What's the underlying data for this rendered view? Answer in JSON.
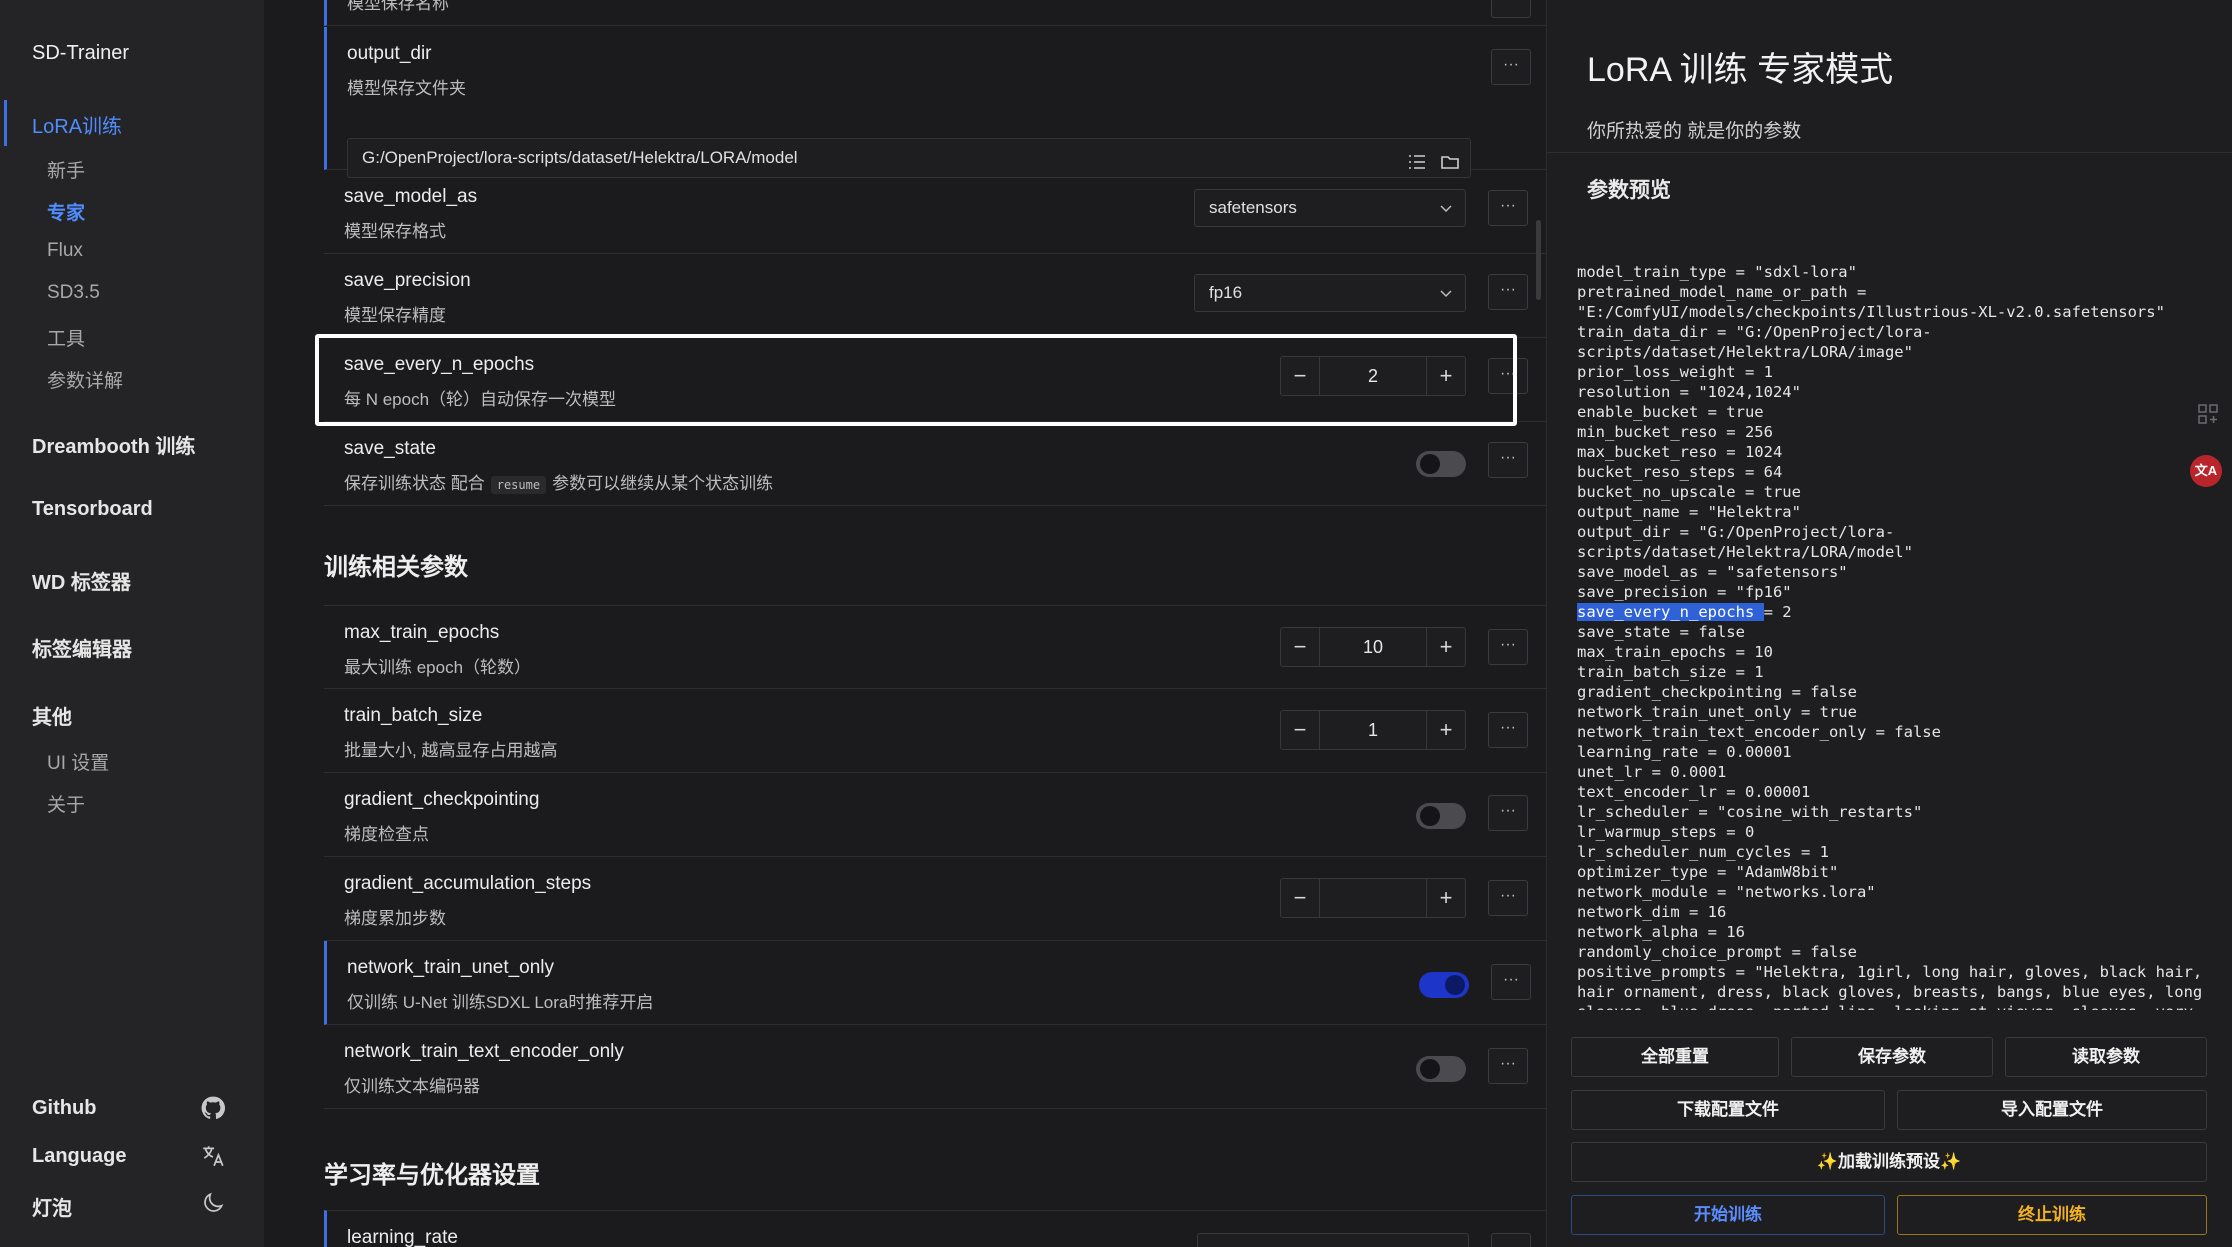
{
  "sidebar": {
    "brand": "SD-Trainer",
    "lora_group": "LoRA训练",
    "lora_items": [
      "新手",
      "专家",
      "Flux",
      "SD3.5",
      "工具",
      "参数详解"
    ],
    "groups": [
      "Dreambooth 训练",
      "Tensorboard",
      "WD 标签器",
      "标签编辑器",
      "其他"
    ],
    "other_items": [
      "UI 设置",
      "关于"
    ],
    "bottom": [
      {
        "label": "Github",
        "icon": "github-icon"
      },
      {
        "label": "Language",
        "icon": "translate-icon"
      },
      {
        "label": "灯泡",
        "icon": "moon-icon"
      }
    ]
  },
  "main": {
    "top_cut_label": "模型保存名称",
    "output_dir": {
      "name": "output_dir",
      "desc": "模型保存文件夹",
      "value": "G:/OpenProject/lora-scripts/dataset/Helektra/LORA/model"
    },
    "save_model_as": {
      "name": "save_model_as",
      "desc": "模型保存格式",
      "value": "safetensors"
    },
    "save_precision": {
      "name": "save_precision",
      "desc": "模型保存精度",
      "value": "fp16"
    },
    "save_every_n_epochs": {
      "name": "save_every_n_epochs",
      "desc": "每 N epoch（轮）自动保存一次模型",
      "value": "2"
    },
    "save_state": {
      "name": "save_state",
      "desc_pre": "保存训练状态 配合",
      "desc_code": "resume",
      "desc_post": "参数可以继续从某个状态训练"
    },
    "section_training": "训练相关参数",
    "max_train_epochs": {
      "name": "max_train_epochs",
      "desc": "最大训练 epoch（轮数）",
      "value": "10"
    },
    "train_batch_size": {
      "name": "train_batch_size",
      "desc": "批量大小, 越高显存占用越高",
      "value": "1"
    },
    "gradient_checkpointing": {
      "name": "gradient_checkpointing",
      "desc": "梯度检查点"
    },
    "gradient_accumulation_steps": {
      "name": "gradient_accumulation_steps",
      "desc": "梯度累加步数",
      "value": ""
    },
    "network_train_unet_only": {
      "name": "network_train_unet_only",
      "desc": "仅训练 U-Net 训练SDXL Lora时推荐开启"
    },
    "network_train_text_encoder_only": {
      "name": "network_train_text_encoder_only",
      "desc": "仅训练文本编码器"
    },
    "section_lr": "学习率与优化器设置",
    "learning_rate": {
      "name": "learning_rate"
    },
    "toggles": {
      "save_state": false,
      "gradient_checkpointing": false,
      "network_train_unet_only": true,
      "network_train_text_encoder_only": false
    },
    "more_label": "···",
    "minus": "−",
    "plus": "+"
  },
  "right": {
    "title": "LoRA 训练 专家模式",
    "subtitle": "你所热爱的 就是你的参数",
    "preview_label": "参数预览",
    "code_before": "model_train_type = \"sdxl-lora\"\npretrained_model_name_or_path = \n\"E:/ComfyUI/models/checkpoints/Illustrious-XL-v2.0.safetensors\"\ntrain_data_dir = \"G:/OpenProject/lora-\nscripts/dataset/Helektra/LORA/image\"\nprior_loss_weight = 1\nresolution = \"1024,1024\"\nenable_bucket = true\nmin_bucket_reso = 256\nmax_bucket_reso = 1024\nbucket_reso_steps = 64\nbucket_no_upscale = true\noutput_name = \"Helektra\"\noutput_dir = \"G:/OpenProject/lora-\nscripts/dataset/Helektra/LORA/model\"\nsave_model_as = \"safetensors\"\nsave_precision = \"fp16\"\n",
    "code_highlight": "save_every_n_epochs ",
    "code_after": "= 2\nsave_state = false\nmax_train_epochs = 10\ntrain_batch_size = 1\ngradient_checkpointing = false\nnetwork_train_unet_only = true\nnetwork_train_text_encoder_only = false\nlearning_rate = 0.00001\nunet_lr = 0.0001\ntext_encoder_lr = 0.00001\nlr_scheduler = \"cosine_with_restarts\"\nlr_warmup_steps = 0\nlr_scheduler_num_cycles = 1\noptimizer_type = \"AdamW8bit\"\nnetwork_module = \"networks.lora\"\nnetwork_dim = 16\nnetwork_alpha = 16\nrandomly_choice_prompt = false\npositive_prompts = \"Helektra, 1girl, long hair, gloves, black hair,\nhair ornament, dress, black gloves, breasts, bangs, blue eyes, long\nsleeves, blue dress, parted lips, looking at viewer, sleeves, very",
    "buttons": {
      "reset": "全部重置",
      "save": "保存参数",
      "load": "读取参数",
      "download": "下载配置文件",
      "import": "导入配置文件",
      "preset": "✨加载训练预设✨",
      "start": "开始训练",
      "stop": "终止训练"
    },
    "float_badge": "文A"
  },
  "colors": {
    "accent": "#3d6fe8",
    "link": "#4f8cff",
    "stop": "#f4b11f",
    "toggle_on": "#1d35c9"
  }
}
